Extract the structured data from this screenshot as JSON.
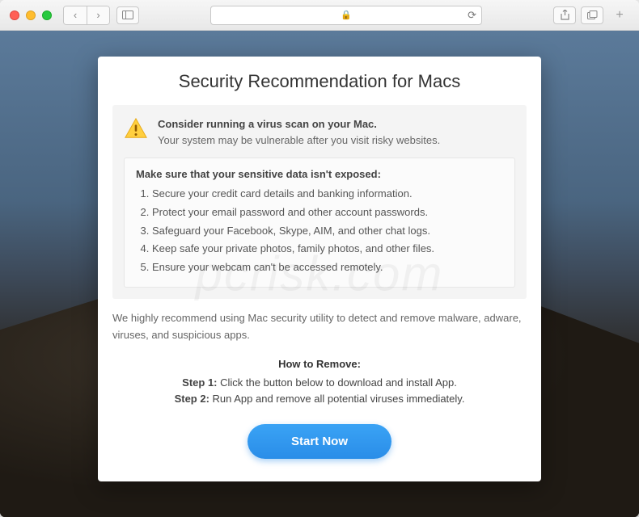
{
  "toolbar": {
    "lock_icon": "🔒",
    "reload_icon": "⟳",
    "back_icon": "‹",
    "forward_icon": "›",
    "share_icon": "⎋",
    "tabs_icon": "⧉",
    "plus": "+"
  },
  "card": {
    "title": "Security Recommendation for Macs",
    "alert_heading": "Consider running a virus scan on your Mac.",
    "alert_sub": "Your system may be vulnerable after you visit risky websites.",
    "list_title": "Make sure that your sensitive data isn't exposed:",
    "list_items": [
      "Secure your credit card details and banking information.",
      "Protect your email password and other account passwords.",
      "Safeguard your Facebook, Skype, AIM, and other chat logs.",
      "Keep safe your private photos, family photos, and other files.",
      "Ensure your webcam can't be accessed remotely."
    ],
    "recommend": "We highly recommend using Mac security utility to detect and remove malware, adware, viruses, and suspicious apps.",
    "howto_title": "How to Remove:",
    "step1_label": "Step 1:",
    "step1_text": " Click the button below to download and install App.",
    "step2_label": "Step 2:",
    "step2_text": " Run App and remove all potential viruses immediately.",
    "cta_label": "Start Now"
  },
  "watermark": "pcrisk.com"
}
